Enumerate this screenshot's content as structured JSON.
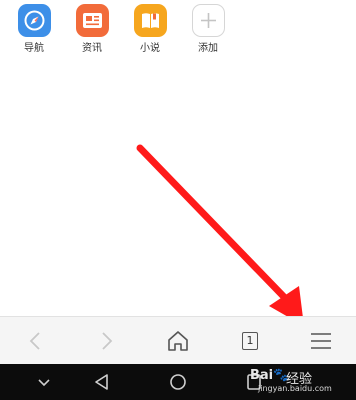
{
  "shortcuts": [
    {
      "label": "导航",
      "icon": "compass-icon",
      "color": "#3d8fe8"
    },
    {
      "label": "资讯",
      "icon": "news-icon",
      "color": "#f26b3a"
    },
    {
      "label": "小说",
      "icon": "book-icon",
      "color": "#f6a61e"
    },
    {
      "label": "添加",
      "icon": "plus-icon",
      "color": "#ffffff"
    }
  ],
  "toolbar": {
    "back_icon": "chevron-left-icon",
    "forward_icon": "chevron-right-icon",
    "home_icon": "home-icon",
    "tab_count": "1",
    "menu_icon": "menu-icon"
  },
  "annotation": {
    "arrow_color": "#ff1a1a"
  },
  "system_nav": {
    "buttons": [
      "chevron-down-icon",
      "triangle-back-icon",
      "circle-home-icon",
      "square-recents-icon"
    ]
  },
  "watermark": {
    "logo": "Bai🐾",
    "title": "经验",
    "url": "jingyan.baidu.com"
  }
}
